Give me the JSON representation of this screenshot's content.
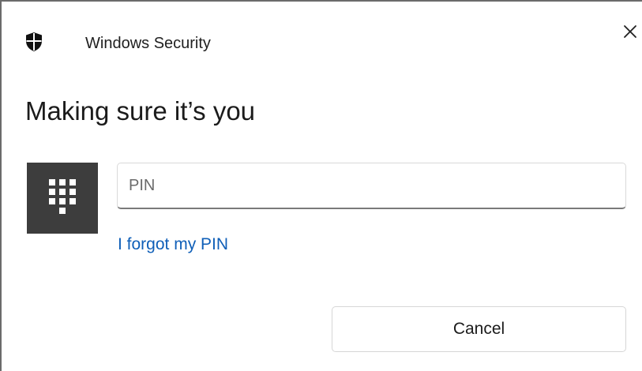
{
  "window": {
    "title": "Windows Security",
    "app_icon": "shield-icon",
    "close_icon": "close-icon"
  },
  "main": {
    "heading": "Making sure it’s you",
    "keypad_icon": "keypad-icon",
    "pin_field": {
      "placeholder": "PIN",
      "value": ""
    },
    "forgot_link": "I forgot my PIN",
    "cancel_label": "Cancel"
  },
  "colors": {
    "link": "#0f5fb8",
    "keypad_tile": "#3d3d3d",
    "window_border": "#6b6b6b"
  }
}
